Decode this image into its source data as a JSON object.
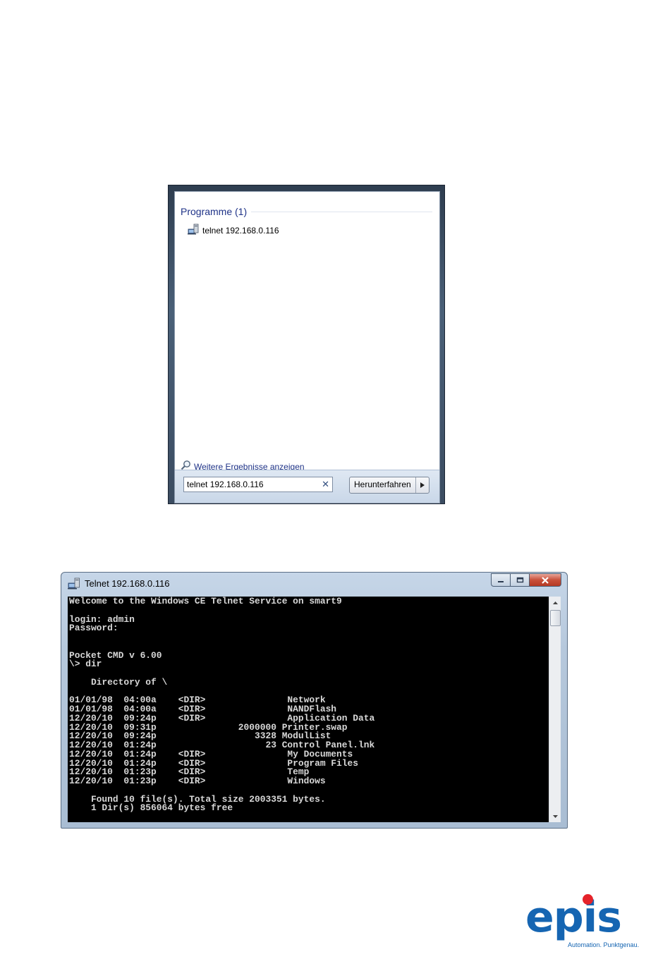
{
  "start_menu": {
    "section_title": "Programme (1)",
    "result_item": "telnet 192.168.0.116",
    "more_results": "Weitere Ergebnisse anzeigen",
    "search_value": "telnet 192.168.0.116",
    "shutdown_label": "Herunterfahren"
  },
  "telnet_window": {
    "title": "Telnet 192.168.0.116",
    "console_lines": [
      "Welcome to the Windows CE Telnet Service on smart9",
      "",
      "login: admin",
      "Password:",
      "",
      "",
      "Pocket CMD v 6.00",
      "\\> dir",
      "",
      "    Directory of \\",
      "",
      "01/01/98  04:00a    <DIR>               Network",
      "01/01/98  04:00a    <DIR>               NANDFlash",
      "12/20/10  09:24p    <DIR>               Application Data",
      "12/20/10  09:31p               2000000 Printer.swap",
      "12/20/10  09:24p                  3328 ModulList",
      "12/20/10  01:24p                    23 Control Panel.lnk",
      "12/20/10  01:24p    <DIR>               My Documents",
      "12/20/10  01:24p    <DIR>               Program Files",
      "12/20/10  01:23p    <DIR>               Temp",
      "12/20/10  01:23p    <DIR>               Windows",
      "",
      "    Found 10 file(s). Total size 2003351 bytes.",
      "    1 Dir(s) 856064 bytes free"
    ]
  },
  "logo": {
    "wordmark": "epis",
    "tagline": "Automation. Punktgenau.",
    "primary_color": "#1565b2",
    "dot_color": "#e5232a"
  },
  "icons": {
    "program_icon": "computer-icon",
    "search_icon": "magnifier-icon",
    "clear_icon": "close-x-icon",
    "arrow_icon": "triangle-right-icon"
  }
}
